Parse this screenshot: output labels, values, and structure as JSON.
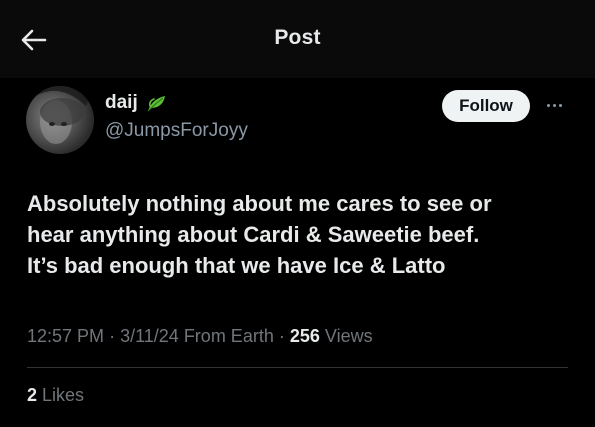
{
  "header": {
    "title": "Post",
    "back_icon": "arrow-left-icon"
  },
  "author": {
    "display_name": "daij",
    "badge_icon": "leaf-icon",
    "handle": "@JumpsForJoyy"
  },
  "actions": {
    "follow_label": "Follow",
    "more_icon": "more-horizontal-icon"
  },
  "tweet": {
    "lines": [
      "Absolutely nothing about me cares to see or",
      "hear anything about Cardi & Saweetie beef.",
      "It’s bad enough that we have Ice & Latto"
    ]
  },
  "meta": {
    "time": "12:57 PM",
    "date": "3/11/24",
    "source": "From Earth",
    "views_count": "256",
    "views_label": "Views"
  },
  "stats": {
    "likes_count": "2",
    "likes_label": "Likes"
  },
  "colors": {
    "background": "#000000",
    "text": "#e7e9ea",
    "secondary_text": "#71767b",
    "follow_button": "#eff3f4",
    "leaf": "#5fbf3a"
  }
}
